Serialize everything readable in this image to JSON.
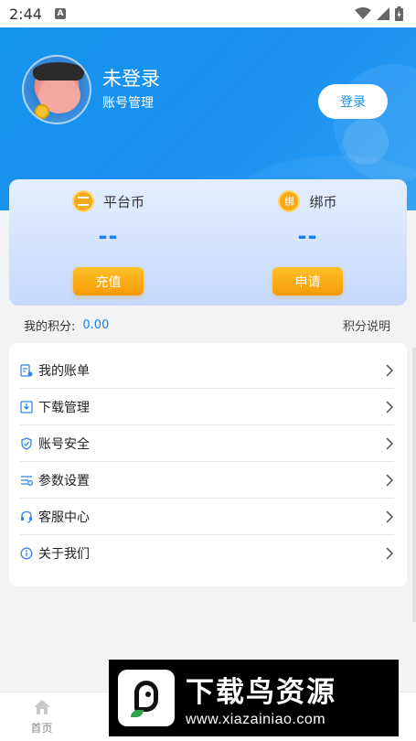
{
  "status_bar": {
    "time": "2:44",
    "notification_badge": "A",
    "icons": [
      "wifi-icon",
      "signal-icon",
      "battery-icon"
    ]
  },
  "header": {
    "user_name": "未登录",
    "subtitle": "账号管理",
    "login_button": "登录"
  },
  "currencies": [
    {
      "name": "平台币",
      "icon": "coin-stack-icon",
      "value": "--",
      "button": "充值"
    },
    {
      "name": "绑币",
      "icon_text": "绑",
      "value": "--",
      "button": "申请"
    }
  ],
  "points": {
    "label": "我的积分:",
    "value": "0.00",
    "help_link": "积分说明"
  },
  "menu": [
    {
      "label": "我的账单",
      "icon": "bill-icon"
    },
    {
      "label": "下载管理",
      "icon": "download-icon"
    },
    {
      "label": "账号安全",
      "icon": "shield-icon"
    },
    {
      "label": "参数设置",
      "icon": "settings-sliders-icon"
    },
    {
      "label": "客服中心",
      "icon": "headset-icon"
    },
    {
      "label": "关于我们",
      "icon": "info-icon"
    }
  ],
  "tabbar": [
    {
      "label": "首页",
      "icon": "home-icon"
    }
  ],
  "watermark": {
    "title": "下载鸟资源",
    "url": "www.xiazainiao.com"
  },
  "colors": {
    "header_blue": "#1a8ff0",
    "accent_blue": "#1a7ff0",
    "button_orange": "#f59a08",
    "coin_gold": "#f7a91a"
  }
}
